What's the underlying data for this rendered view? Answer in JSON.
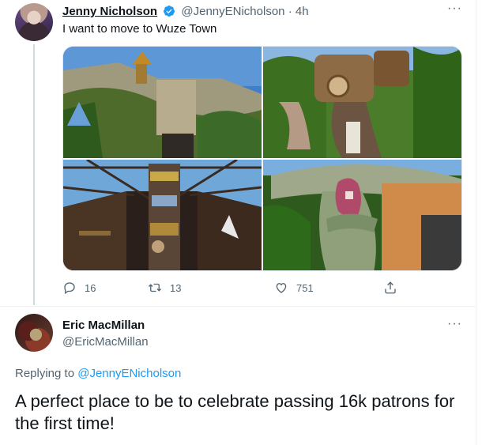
{
  "tweet": {
    "author_name": "Jenny Nicholson",
    "author_handle": "@JennyENicholson",
    "time": "4h",
    "separator": "·",
    "text": "I want to move to Wuze Town",
    "more": "···",
    "stats": {
      "replies": "16",
      "retweets": "13",
      "likes": "751"
    }
  },
  "reply": {
    "author_name": "Eric MacMillan",
    "author_handle": "@EricMacMillan",
    "more": "···",
    "replying_prefix": "Replying to ",
    "replying_handle": "@JennyENicholson",
    "text": "A perfect place to be to celebrate passing 16k patrons for the first time!"
  },
  "colors": {
    "accent": "#1d9bf0",
    "muted": "#536471",
    "text": "#0f1419"
  },
  "icons": [
    "verified-badge-icon",
    "reply-icon",
    "retweet-icon",
    "like-icon",
    "share-icon",
    "more-icon"
  ]
}
